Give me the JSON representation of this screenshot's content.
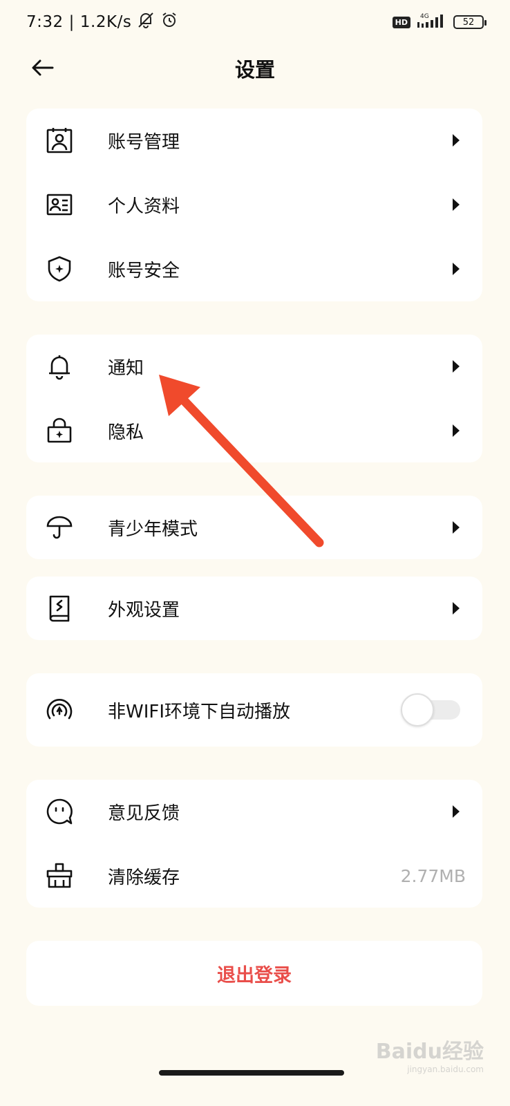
{
  "status_bar": {
    "time": "7:32",
    "separator": "|",
    "net_speed": "1.2K/s",
    "hd_badge": "HD",
    "network": "4G",
    "battery": "52"
  },
  "header": {
    "title": "设置",
    "back_icon": "arrow-left-icon"
  },
  "groups": {
    "account": {
      "items": [
        {
          "label": "账号管理",
          "icon": "account-card-icon"
        },
        {
          "label": "个人资料",
          "icon": "profile-card-icon"
        },
        {
          "label": "账号安全",
          "icon": "shield-icon"
        }
      ]
    },
    "notify": {
      "items": [
        {
          "label": "通知",
          "icon": "bell-icon"
        },
        {
          "label": "隐私",
          "icon": "lock-icon"
        }
      ]
    },
    "youth": {
      "label": "青少年模式",
      "icon": "umbrella-icon"
    },
    "appearance": {
      "label": "外观设置",
      "icon": "book-icon"
    },
    "autoplay": {
      "label": "非WIFI环境下自动播放",
      "icon": "signal-play-icon",
      "enabled": false
    },
    "misc": {
      "items": [
        {
          "label": "意见反馈",
          "icon": "chat-face-icon"
        },
        {
          "label": "清除缓存",
          "icon": "broom-icon",
          "value": "2.77MB"
        }
      ]
    }
  },
  "logout_label": "退出登录",
  "colors": {
    "background": "#fdfaf1",
    "card": "#ffffff",
    "logout": "#e94e4a",
    "annotation": "#f04a2c"
  },
  "watermark": {
    "brand": "Baidu经验",
    "url": "jingyan.baidu.com"
  }
}
